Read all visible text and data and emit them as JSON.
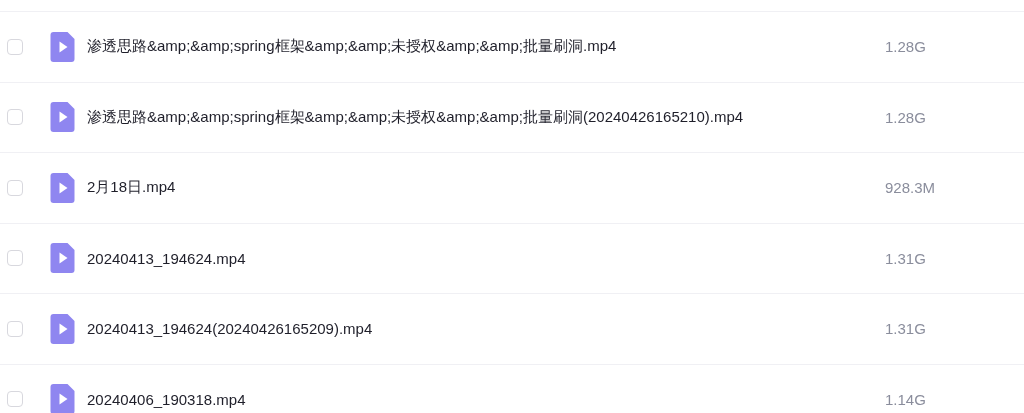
{
  "files": [
    {
      "name": "渗透思路&amp;&amp;spring框架&amp;&amp;未授权&amp;&amp;批量刷洞.mp4",
      "size": "1.28G",
      "checked": false
    },
    {
      "name": "渗透思路&amp;&amp;spring框架&amp;&amp;未授权&amp;&amp;批量刷洞(20240426165210).mp4",
      "size": "1.28G",
      "checked": false
    },
    {
      "name": "2月18日.mp4",
      "size": "928.3M",
      "checked": false
    },
    {
      "name": "20240413_194624.mp4",
      "size": "1.31G",
      "checked": false
    },
    {
      "name": "20240413_194624(20240426165209).mp4",
      "size": "1.31G",
      "checked": false
    },
    {
      "name": "20240406_190318.mp4",
      "size": "1.14G",
      "checked": false
    }
  ]
}
